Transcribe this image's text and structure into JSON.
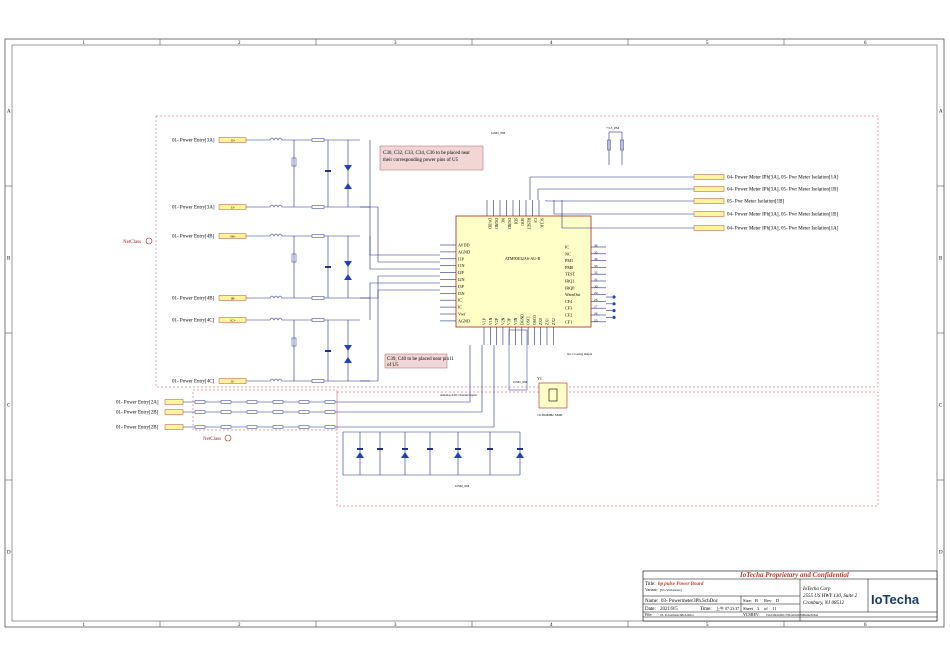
{
  "border": {
    "columns": [
      "1",
      "2",
      "3",
      "4",
      "5",
      "6"
    ],
    "rows": [
      "A",
      "B",
      "C",
      "D"
    ]
  },
  "notes": {
    "note1": [
      "C30, C32, C33, C34, C36 to be placed near",
      "their corresponding power pins of U5"
    ],
    "note2": [
      "C39, C40 to be placed near pin11",
      "of U5"
    ]
  },
  "ic": {
    "name": "ATM90E32AS-AU-R",
    "left_pins": [
      "AVDD",
      "AGND",
      "I1P",
      "I1N",
      "I2P",
      "I2N",
      "I3P",
      "I3N",
      "IC",
      "IC",
      "Vref",
      "AGND"
    ],
    "top_pins": [
      "DVDD",
      "DGND",
      "NC",
      "DGND",
      "SDI",
      "SDO",
      "RESET",
      "CS",
      "SCLK"
    ],
    "right_pins": [
      "IC",
      "NC",
      "PM1",
      "PM0",
      "TEST",
      "IRQ1",
      "IRQ0",
      "WarnOut",
      "CF4",
      "CF3",
      "CF2",
      "CF1"
    ],
    "right_numbers": [
      "36",
      "35",
      "34",
      "33",
      "32",
      "31",
      "30",
      "29",
      "28",
      "27",
      "26",
      "25"
    ],
    "bottom_pins": [
      "V1P",
      "V1N",
      "V2P",
      "V2N",
      "V3P",
      "V3N",
      "DGND",
      "OSCI",
      "OSCO",
      "ZX0",
      "ZX1",
      "ZX2"
    ]
  },
  "entries_left": [
    "01- Power Entry[3A]",
    "01- Power Entry[3A]",
    "01- Power Entry[4B]",
    "01- Power Entry[4B]",
    "01- Power Entry[4C]",
    "01- Power Entry[4C]"
  ],
  "entries_left_bus": [
    "I3+",
    "I3-",
    "IB+",
    "IB-",
    "IC+",
    "IC-"
  ],
  "entries_lower": [
    "01- Power Entry[2A]",
    "01- Power Entry[2B]",
    "01- Power Entry[2B]"
  ],
  "net_labels": {
    "netclass_top": "NetClass",
    "netclass_bottom": "NetClass",
    "gnd_pm": "GND_PM",
    "vcc_pm": "+3.3_PM",
    "anti_alias": "Antialias ADC Channel Inputs",
    "crystal": "Y1",
    "crystal_part": "16.384MHz SMD",
    "osc_note": "Osc Crossing Output"
  },
  "right_outputs": [
    "04- Power Meter IPh[3A], 05- Pwr Meter Isolation[1A]",
    "04- Power Meter IPh[3A], 05- Pwr Meter Isolation[1B]",
    "05- Pwr Meter Isolation[1B]",
    "04- Power Meter IPh[3A], 05- Pwr Meter Isolation[1B]",
    "04- Power Meter IPh[3A], 05- Pwr Meter Isolation[1A]"
  ],
  "title_block": {
    "banner": "IoTecha Proprietary and Confidential",
    "title_label": "Title:",
    "title_value": "bp pulse Power Board",
    "variant_label": "Variant:",
    "variant_value": "[No Variations]",
    "name_label": "Name:",
    "name_value": "03- Powermeter3Ph.SchDoc",
    "size_label": "Size:",
    "size_value": "B",
    "rev_label": "Rev:",
    "rev_value": "D",
    "date_label": "Date:",
    "date_value": "2021/8/5",
    "time_label": "Time:",
    "time_value": "上午 07:23:37",
    "sheet_label": "Sheet",
    "sheet_value": "3",
    "of_label": "of",
    "sheet_total": "11",
    "file_label": "File:",
    "file_value": "03- Powermeter3Ph.SchDoc",
    "vcsrev_label": "VCSREV:",
    "vcsrev_value": "f32cf26bb2b81178d1a012dd588ad4e5b6ad",
    "company": "IoTecha Corp",
    "addr1": "2555 US HWY 130, Suite 2",
    "addr2": "Cranbury, NJ 08512",
    "logo": "IoTecha"
  }
}
